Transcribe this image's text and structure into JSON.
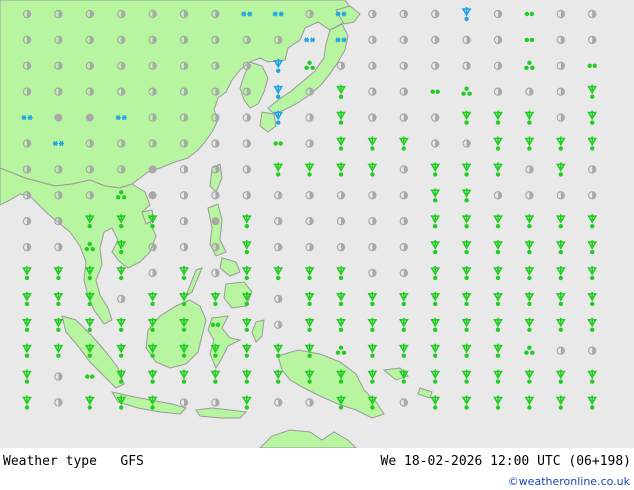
{
  "map": {
    "title": "Weather type",
    "model": "GFS",
    "valid_time": "We 18-02-2026 12:00 UTC (06+198)",
    "credit": "©weatheronline.co.uk",
    "colors": {
      "sea": "#e9e9e9",
      "land": "#b7f5a0",
      "coast": "#9a9a9a",
      "rain": "#22cc22",
      "snow": "#1fa3e6",
      "dry": "#a8a8a8",
      "credit": "#1a47b8"
    },
    "legend_symbols": [
      "dry-dot",
      "cloud-half",
      "drizzle",
      "rain-shower",
      "showers-triangle",
      "snow-star",
      "snow-shower"
    ],
    "grid_cols": 19,
    "grid_rows": 16
  }
}
